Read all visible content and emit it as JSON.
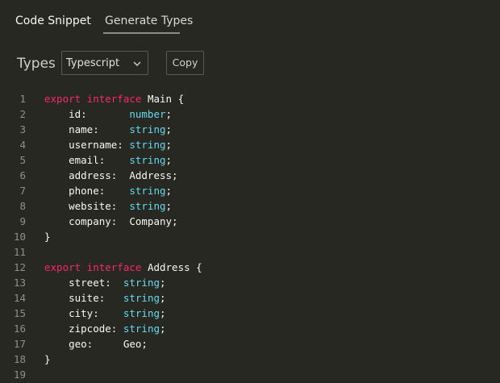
{
  "tabs": [
    {
      "label": "Code Snippet",
      "active": false
    },
    {
      "label": "Generate Types",
      "active": true
    }
  ],
  "toolbar": {
    "label": "Types",
    "language_select": {
      "value": "Typescript",
      "icon": "chevron-down-icon"
    },
    "copy_label": "Copy"
  },
  "colors": {
    "background": "#272822",
    "keyword": "#f92672",
    "type": "#66d9ef",
    "text": "#f8f8f2",
    "line_number": "#8f908a"
  },
  "code_lines": [
    {
      "n": "1",
      "tokens": [
        {
          "t": "export interface ",
          "c": "kw"
        },
        {
          "t": "Main {",
          "c": "pl"
        }
      ]
    },
    {
      "n": "2",
      "tokens": [
        {
          "t": "    id:       ",
          "c": "pl"
        },
        {
          "t": "number",
          "c": "ty"
        },
        {
          "t": ";",
          "c": "pl"
        }
      ]
    },
    {
      "n": "3",
      "tokens": [
        {
          "t": "    name:     ",
          "c": "pl"
        },
        {
          "t": "string",
          "c": "ty"
        },
        {
          "t": ";",
          "c": "pl"
        }
      ]
    },
    {
      "n": "4",
      "tokens": [
        {
          "t": "    username: ",
          "c": "pl"
        },
        {
          "t": "string",
          "c": "ty"
        },
        {
          "t": ";",
          "c": "pl"
        }
      ]
    },
    {
      "n": "5",
      "tokens": [
        {
          "t": "    email:    ",
          "c": "pl"
        },
        {
          "t": "string",
          "c": "ty"
        },
        {
          "t": ";",
          "c": "pl"
        }
      ]
    },
    {
      "n": "6",
      "tokens": [
        {
          "t": "    address:  Address;",
          "c": "pl"
        }
      ]
    },
    {
      "n": "7",
      "tokens": [
        {
          "t": "    phone:    ",
          "c": "pl"
        },
        {
          "t": "string",
          "c": "ty"
        },
        {
          "t": ";",
          "c": "pl"
        }
      ]
    },
    {
      "n": "8",
      "tokens": [
        {
          "t": "    website:  ",
          "c": "pl"
        },
        {
          "t": "string",
          "c": "ty"
        },
        {
          "t": ";",
          "c": "pl"
        }
      ]
    },
    {
      "n": "9",
      "tokens": [
        {
          "t": "    company:  Company;",
          "c": "pl"
        }
      ]
    },
    {
      "n": "10",
      "tokens": [
        {
          "t": "}",
          "c": "pl"
        }
      ]
    },
    {
      "n": "11",
      "tokens": []
    },
    {
      "n": "12",
      "tokens": [
        {
          "t": "export interface ",
          "c": "kw"
        },
        {
          "t": "Address {",
          "c": "pl"
        }
      ]
    },
    {
      "n": "13",
      "tokens": [
        {
          "t": "    street:  ",
          "c": "pl"
        },
        {
          "t": "string",
          "c": "ty"
        },
        {
          "t": ";",
          "c": "pl"
        }
      ]
    },
    {
      "n": "14",
      "tokens": [
        {
          "t": "    suite:   ",
          "c": "pl"
        },
        {
          "t": "string",
          "c": "ty"
        },
        {
          "t": ";",
          "c": "pl"
        }
      ]
    },
    {
      "n": "15",
      "tokens": [
        {
          "t": "    city:    ",
          "c": "pl"
        },
        {
          "t": "string",
          "c": "ty"
        },
        {
          "t": ";",
          "c": "pl"
        }
      ]
    },
    {
      "n": "16",
      "tokens": [
        {
          "t": "    zipcode: ",
          "c": "pl"
        },
        {
          "t": "string",
          "c": "ty"
        },
        {
          "t": ";",
          "c": "pl"
        }
      ]
    },
    {
      "n": "17",
      "tokens": [
        {
          "t": "    geo:     Geo;",
          "c": "pl"
        }
      ]
    },
    {
      "n": "18",
      "tokens": [
        {
          "t": "}",
          "c": "pl"
        }
      ]
    },
    {
      "n": "19",
      "tokens": []
    }
  ]
}
